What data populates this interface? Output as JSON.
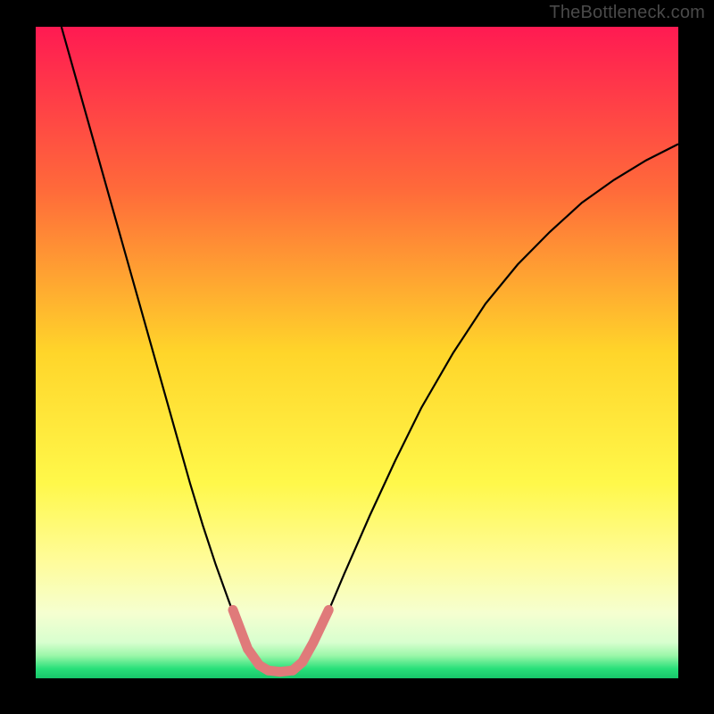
{
  "watermark": "TheBottleneck.com",
  "chart_data": {
    "type": "line",
    "title": "",
    "xlabel": "",
    "ylabel": "",
    "xlim": [
      0,
      100
    ],
    "ylim": [
      0,
      100
    ],
    "background_gradient": {
      "stops": [
        {
          "pos": 0.0,
          "color": "#ff1a52"
        },
        {
          "pos": 0.25,
          "color": "#ff6a3a"
        },
        {
          "pos": 0.5,
          "color": "#ffd52a"
        },
        {
          "pos": 0.7,
          "color": "#fff84a"
        },
        {
          "pos": 0.82,
          "color": "#fffc9a"
        },
        {
          "pos": 0.9,
          "color": "#f5ffd0"
        },
        {
          "pos": 0.945,
          "color": "#d8ffcf"
        },
        {
          "pos": 0.965,
          "color": "#9cf7a9"
        },
        {
          "pos": 0.985,
          "color": "#29e07a"
        },
        {
          "pos": 1.0,
          "color": "#17c76a"
        }
      ]
    },
    "series": [
      {
        "name": "bottleneck-curve",
        "color": "#000000",
        "width": 2.2,
        "data": [
          {
            "x": 4.0,
            "y": 100.0
          },
          {
            "x": 6.0,
            "y": 93.0
          },
          {
            "x": 8.0,
            "y": 86.0
          },
          {
            "x": 10.0,
            "y": 79.0
          },
          {
            "x": 12.0,
            "y": 72.0
          },
          {
            "x": 14.0,
            "y": 65.0
          },
          {
            "x": 16.0,
            "y": 58.0
          },
          {
            "x": 18.0,
            "y": 51.0
          },
          {
            "x": 20.0,
            "y": 44.0
          },
          {
            "x": 22.0,
            "y": 37.0
          },
          {
            "x": 24.0,
            "y": 30.0
          },
          {
            "x": 26.0,
            "y": 23.5
          },
          {
            "x": 28.0,
            "y": 17.5
          },
          {
            "x": 30.0,
            "y": 12.0
          },
          {
            "x": 31.5,
            "y": 8.0
          },
          {
            "x": 33.0,
            "y": 4.5
          },
          {
            "x": 34.5,
            "y": 2.2
          },
          {
            "x": 36.0,
            "y": 1.2
          },
          {
            "x": 38.0,
            "y": 1.0
          },
          {
            "x": 40.0,
            "y": 1.2
          },
          {
            "x": 41.5,
            "y": 2.5
          },
          {
            "x": 43.0,
            "y": 5.0
          },
          {
            "x": 45.0,
            "y": 9.0
          },
          {
            "x": 48.0,
            "y": 16.0
          },
          {
            "x": 52.0,
            "y": 25.0
          },
          {
            "x": 56.0,
            "y": 33.5
          },
          {
            "x": 60.0,
            "y": 41.5
          },
          {
            "x": 65.0,
            "y": 50.0
          },
          {
            "x": 70.0,
            "y": 57.5
          },
          {
            "x": 75.0,
            "y": 63.5
          },
          {
            "x": 80.0,
            "y": 68.5
          },
          {
            "x": 85.0,
            "y": 73.0
          },
          {
            "x": 90.0,
            "y": 76.5
          },
          {
            "x": 95.0,
            "y": 79.5
          },
          {
            "x": 100.0,
            "y": 82.0
          }
        ]
      }
    ],
    "marker_band": {
      "color": "#e07a7a",
      "width": 11,
      "threshold_y": 10.5,
      "left": [
        {
          "x": 30.7,
          "y": 10.5
        },
        {
          "x": 33.0,
          "y": 4.5
        },
        {
          "x": 34.8,
          "y": 2.0
        },
        {
          "x": 36.2,
          "y": 1.2
        }
      ],
      "bottom": [
        {
          "x": 36.2,
          "y": 1.2
        },
        {
          "x": 38.0,
          "y": 1.0
        },
        {
          "x": 40.0,
          "y": 1.2
        }
      ],
      "right": [
        {
          "x": 40.0,
          "y": 1.2
        },
        {
          "x": 41.5,
          "y": 2.5
        },
        {
          "x": 43.2,
          "y": 5.5
        },
        {
          "x": 45.6,
          "y": 10.5
        }
      ]
    }
  }
}
